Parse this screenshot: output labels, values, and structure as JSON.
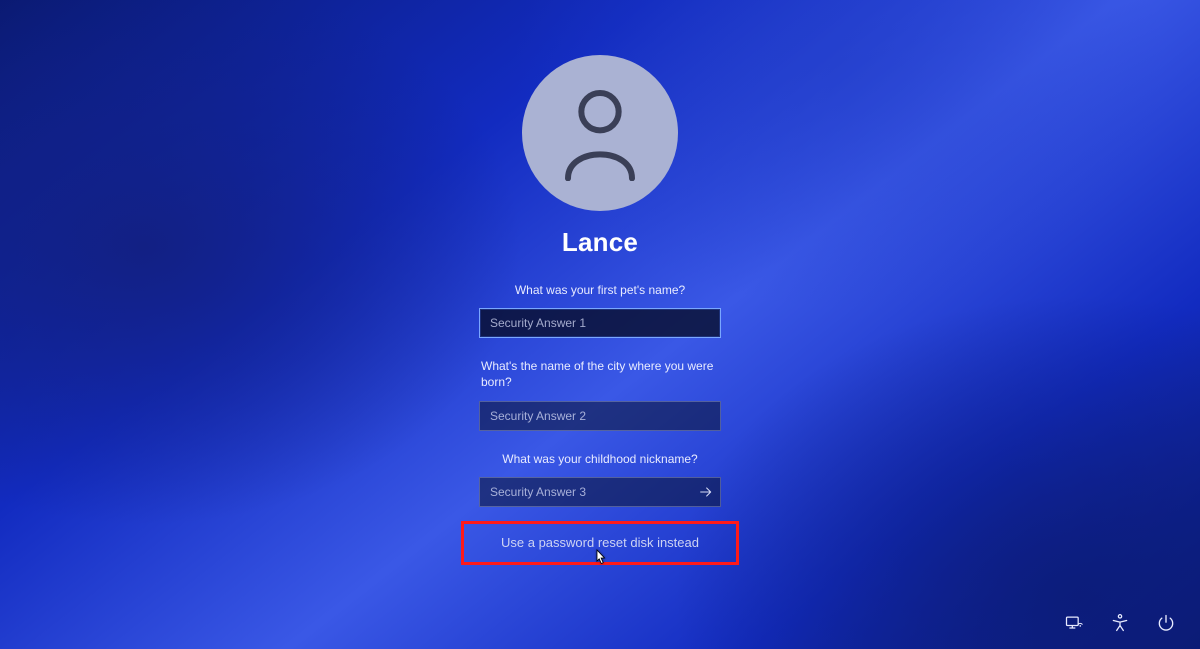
{
  "user": {
    "name": "Lance"
  },
  "questions": {
    "q1": "What was your first pet's name?",
    "q2": "What's the name of the city where you were born?",
    "q3": "What was your childhood nickname?"
  },
  "placeholders": {
    "a1": "Security Answer 1",
    "a2": "Security Answer 2",
    "a3": "Security Answer 3"
  },
  "reset_link": "Use a password reset disk instead"
}
